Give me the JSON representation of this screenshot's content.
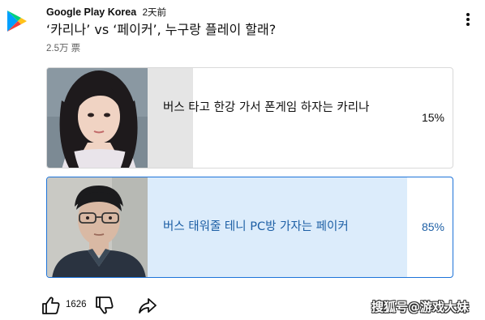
{
  "post": {
    "channel": "Google Play Korea",
    "time": "2天前",
    "title": "‘카리나’ vs ‘페이커’, 누구랑 플레이 할래?",
    "votes": "2.5万 票"
  },
  "poll": {
    "options": [
      {
        "text": "버스 타고 한강 가서 폰게임 하자는 카리나",
        "percent_label": "15%",
        "percent": 15,
        "image": "photo of a woman with long dark hair"
      },
      {
        "text": "버스 태워줄 테니 PC방 가자는 페이커",
        "percent_label": "85%",
        "percent": 85,
        "image": "photo of a man with glasses and a dark jacket",
        "selected": true
      }
    ]
  },
  "actions": {
    "like_count": "1626",
    "like_icon": "thumb-up-icon",
    "dislike_icon": "thumb-down-icon",
    "share_icon": "share-icon"
  },
  "watermark": "搜狐号@游戏大妹",
  "colors": {
    "selected_border": "#1d73d9",
    "selected_fill": "#dcecfb",
    "selected_text": "#1d5fa5",
    "unselected_fill": "#e5e5e5"
  }
}
